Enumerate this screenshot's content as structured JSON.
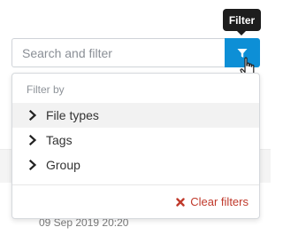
{
  "tooltip": {
    "text": "Filter"
  },
  "search": {
    "placeholder": "Search and filter",
    "value": ""
  },
  "filter_button": {
    "icon": "funnel-icon",
    "color": "#0d8fd6"
  },
  "dropdown": {
    "heading": "Filter by",
    "options": [
      {
        "label": "File types",
        "icon": "chevron-right-icon"
      },
      {
        "label": "Tags",
        "icon": "chevron-right-icon"
      },
      {
        "label": "Group",
        "icon": "chevron-right-icon"
      }
    ],
    "clear_label": "Clear filters",
    "clear_color": "#c0392b"
  },
  "background": {
    "timestamp": "09 Sep 2019 20:20"
  }
}
